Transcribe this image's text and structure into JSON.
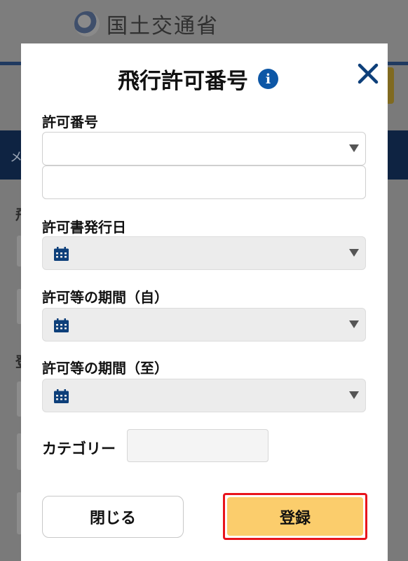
{
  "background": {
    "logo_text": "国土交通省",
    "nav_text": "メ",
    "side_char_1": "飛",
    "side_char_2": "登"
  },
  "modal": {
    "title": "飛行許可番号",
    "info_icon": "info-circle-icon",
    "close_icon": "close-x-icon",
    "fields": {
      "permit_number_label": "許可番号",
      "permit_number_value": "",
      "permit_number_text": "",
      "issue_date_label": "許可書発行日",
      "issue_date_value": "",
      "period_from_label": "許可等の期間（自）",
      "period_from_value": "",
      "period_to_label": "許可等の期間（至）",
      "period_to_value": "",
      "category_label": "カテゴリー",
      "category_value": ""
    },
    "buttons": {
      "close_label": "閉じる",
      "register_label": "登録"
    }
  },
  "colors": {
    "accent_blue": "#0d57a6",
    "register_bg": "#fbcd6c",
    "highlight_red": "#e8141c",
    "disabled_field": "#ececec"
  }
}
